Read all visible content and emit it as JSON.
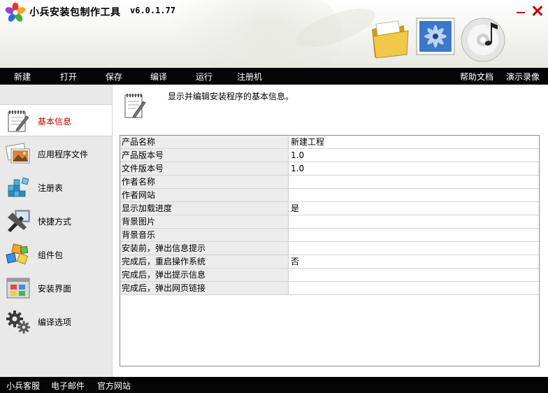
{
  "app": {
    "title": "小兵安装包制作工具",
    "version": "v6.0.1.77",
    "icons": [
      "app-logo-icon",
      "minimize-icon",
      "close-icon",
      "folder-icon",
      "photo-icon",
      "music-disc-icon"
    ]
  },
  "menu": {
    "items": [
      "新建",
      "打开",
      "保存",
      "编译",
      "运行",
      "注册机"
    ],
    "right_items": [
      "帮助文档",
      "演示录像"
    ]
  },
  "sidebar": {
    "items": [
      {
        "label": "基本信息",
        "icon": "notepad-icon",
        "active": true
      },
      {
        "label": "应用程序文件",
        "icon": "picture-icon",
        "active": false
      },
      {
        "label": "注册表",
        "icon": "registry-cubes-icon",
        "active": false
      },
      {
        "label": "快捷方式",
        "icon": "shortcut-icon",
        "active": false
      },
      {
        "label": "组件包",
        "icon": "components-icon",
        "active": false
      },
      {
        "label": "安装界面",
        "icon": "window-ui-icon",
        "active": false
      },
      {
        "label": "编译选项",
        "icon": "gears-icon",
        "active": false
      }
    ]
  },
  "main": {
    "description": "显示并编辑安装程序的基本信息。",
    "properties": [
      {
        "name": "产品名称",
        "value": "新建工程"
      },
      {
        "name": "产品版本号",
        "value": "1.0"
      },
      {
        "name": "文件版本号",
        "value": "1.0"
      },
      {
        "name": "作者名称",
        "value": ""
      },
      {
        "name": "作者网站",
        "value": ""
      },
      {
        "name": "显示加载进度",
        "value": "是"
      },
      {
        "name": "背景图片",
        "value": ""
      },
      {
        "name": "背景音乐",
        "value": ""
      },
      {
        "name": "安装前，弹出信息提示",
        "value": ""
      },
      {
        "name": "完成后，重启操作系统",
        "value": "否"
      },
      {
        "name": "完成后，弹出提示信息",
        "value": ""
      },
      {
        "name": "完成后，弹出网页链接",
        "value": ""
      }
    ]
  },
  "status": {
    "links": [
      "小兵客服",
      "电子邮件",
      "官方网站"
    ]
  },
  "colors": {
    "bar_bg": "#050505",
    "accent_red": "#c00000",
    "sidebar_bg": "#e9e9e9",
    "label_cell_bg": "#ececec"
  }
}
